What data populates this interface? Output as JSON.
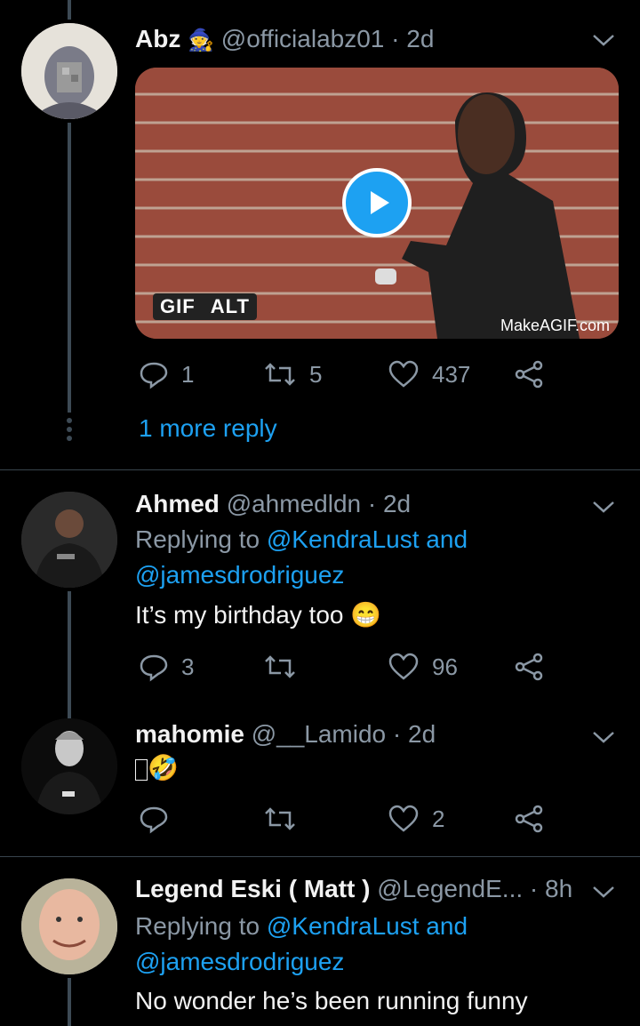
{
  "tweets": [
    {
      "name": "Abz",
      "handle": "@officialabz01",
      "time": "· 2d",
      "media": {
        "badge_gif": "GIF",
        "badge_alt": "ALT",
        "watermark": "MakeAGIF.com"
      },
      "actions": {
        "reply": "1",
        "retweet": "5",
        "like": "437"
      },
      "more_replies": "1 more reply"
    },
    {
      "name": "Ahmed",
      "handle": "@ahmedldn",
      "time": "· 2d",
      "replying_prefix": "Replying to",
      "replying_user1": "@KendraLust",
      "replying_and": "and",
      "replying_user2": "@jamesdrodriguez",
      "text": "It’s my birthday too",
      "actions": {
        "reply": "3",
        "retweet": "",
        "like": "96"
      }
    },
    {
      "name": "mahomie",
      "handle": "@__Lamido",
      "time": "· 2d",
      "text": "🤣",
      "actions": {
        "reply": "",
        "retweet": "",
        "like": "2"
      }
    },
    {
      "name": "Legend Eski ( Matt )",
      "handle": "@LegendE...",
      "time": "· 8h",
      "replying_prefix": "Replying to",
      "replying_user1": "@KendraLust",
      "replying_and": "and",
      "replying_user2": "@jamesdrodriguez",
      "text": "No wonder he’s been running funny"
    }
  ],
  "colors": {
    "accent": "#1da1f2",
    "background": "#000000",
    "muted": "#8b98a5",
    "divider": "#38444d"
  }
}
